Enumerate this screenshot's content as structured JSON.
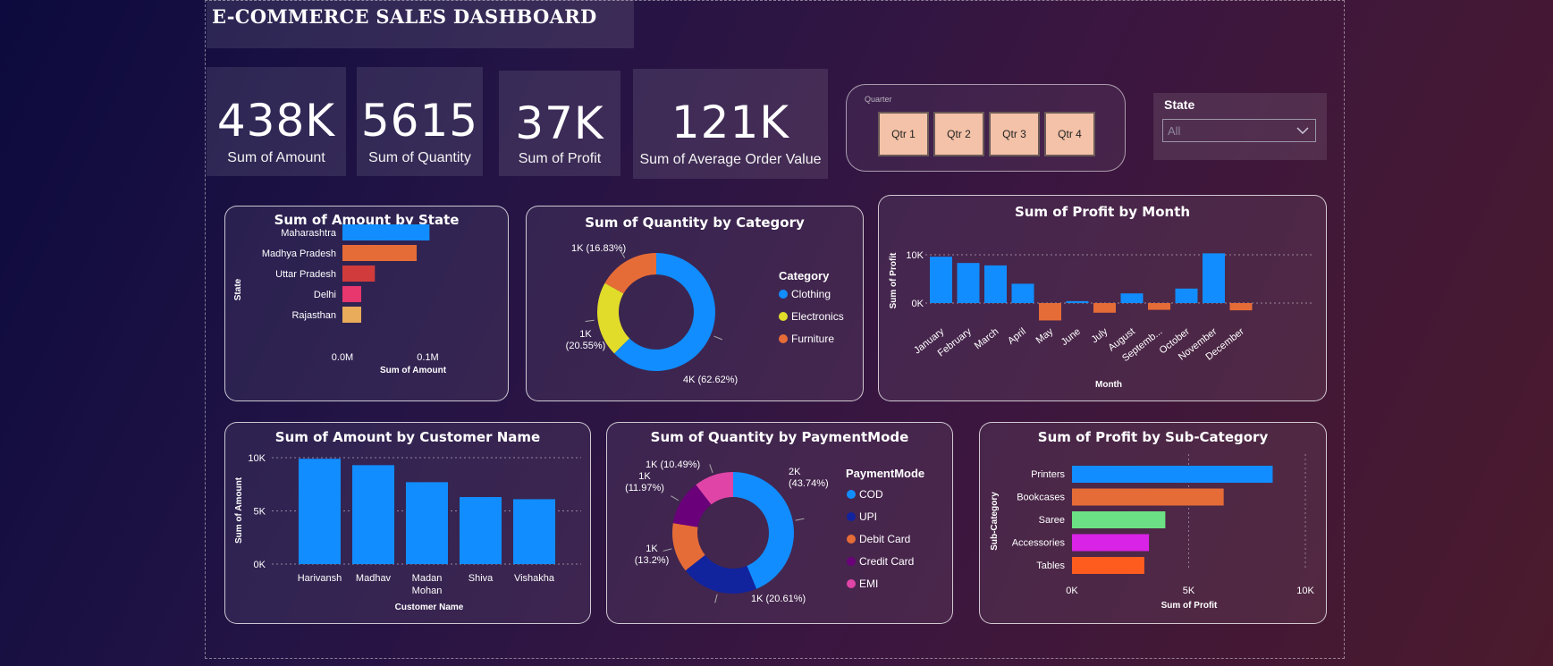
{
  "dashboard": {
    "title": "E-COMMERCE SALES DASHBOARD"
  },
  "kpis": [
    {
      "value": "438K",
      "label": "Sum of Amount"
    },
    {
      "value": "5615",
      "label": "Sum of Quantity"
    },
    {
      "value": "37K",
      "label": "Sum of Profit"
    },
    {
      "value": "121K",
      "label": "Sum of Average Order Value"
    }
  ],
  "quarter_slicer": {
    "caption": "Quarter",
    "buttons": [
      "Qtr 1",
      "Qtr 2",
      "Qtr 3",
      "Qtr 4"
    ]
  },
  "state_slicer": {
    "caption": "State",
    "selected": "All"
  },
  "chart_data": [
    {
      "id": "amount_by_state",
      "type": "bar",
      "orientation": "horizontal",
      "title": "Sum of Amount by State",
      "xlabel": "Sum of Amount",
      "ylabel": "State",
      "categories": [
        "Maharashtra",
        "Madhya Pradesh",
        "Uttar Pradesh",
        "Delhi",
        "Rajasthan"
      ],
      "values": [
        102000,
        87000,
        38000,
        22000,
        22000
      ],
      "colors": [
        "#118dff",
        "#e66c37",
        "#d13b3b",
        "#e8366e",
        "#e8ac5a"
      ],
      "xlim": [
        0,
        110000
      ],
      "xticks": [
        "0.0M",
        "0.1M"
      ],
      "grid": false
    },
    {
      "id": "quantity_by_category",
      "type": "pie",
      "donut": true,
      "title": "Sum of Quantity by Category",
      "legend_title": "Category",
      "legend_position": "right",
      "categories": [
        "Clothing",
        "Electronics",
        "Furniture"
      ],
      "values": [
        62.62,
        20.55,
        16.83
      ],
      "colors": [
        "#118dff",
        "#e1dc2a",
        "#e66c37"
      ],
      "data_labels": [
        "4K (62.62%)",
        "1K (20.55%)",
        "1K (16.83%)"
      ]
    },
    {
      "id": "profit_by_month",
      "type": "bar",
      "title": "Sum of Profit by Month",
      "xlabel": "Month",
      "ylabel": "Sum of Profit",
      "categories": [
        "January",
        "February",
        "March",
        "April",
        "May",
        "June",
        "July",
        "August",
        "Septemb...",
        "October",
        "November",
        "December"
      ],
      "values": [
        9600,
        8300,
        7800,
        4000,
        -3600,
        400,
        -2000,
        2000,
        -1400,
        3000,
        10300,
        -1500
      ],
      "positive_color": "#118dff",
      "negative_color": "#e66c37",
      "ylim": [
        -4000,
        11000
      ],
      "yticks": [
        {
          "value": 10000,
          "label": "10K"
        },
        {
          "value": 0,
          "label": "0K"
        }
      ],
      "grid": true
    },
    {
      "id": "amount_by_customer",
      "type": "bar",
      "title": "Sum of Amount by Customer Name",
      "xlabel": "Customer Name",
      "ylabel": "Sum of Amount",
      "categories": [
        "Harivansh",
        "Madhav",
        "Madan Mohan",
        "Shiva",
        "Vishakha"
      ],
      "values": [
        9900,
        9300,
        7700,
        6300,
        6100
      ],
      "color": "#118dff",
      "ylim": [
        0,
        10000
      ],
      "yticks": [
        {
          "value": 10000,
          "label": "10K"
        },
        {
          "value": 5000,
          "label": "5K"
        },
        {
          "value": 0,
          "label": "0K"
        }
      ],
      "grid": true
    },
    {
      "id": "quantity_by_paymentmode",
      "type": "pie",
      "donut": true,
      "title": "Sum of Quantity by PaymentMode",
      "legend_title": "PaymentMode",
      "legend_position": "right",
      "categories": [
        "COD",
        "UPI",
        "Debit Card",
        "Credit Card",
        "EMI"
      ],
      "values": [
        43.74,
        20.61,
        13.2,
        11.97,
        10.49
      ],
      "colors": [
        "#118dff",
        "#12239e",
        "#e66c37",
        "#6b007b",
        "#e044a7"
      ],
      "data_labels": [
        "2K (43.74%)",
        "1K (20.61%)",
        "1K (13.2%)",
        "1K (11.97%)",
        "1K (10.49%)"
      ]
    },
    {
      "id": "profit_by_subcategory",
      "type": "bar",
      "orientation": "horizontal",
      "title": "Sum of Profit by Sub-Category",
      "xlabel": "Sum of Profit",
      "ylabel": "Sub-Category",
      "categories": [
        "Printers",
        "Bookcases",
        "Saree",
        "Accessories",
        "Tables"
      ],
      "values": [
        8600,
        6500,
        4000,
        3300,
        3100
      ],
      "colors": [
        "#118dff",
        "#e66c37",
        "#6ce084",
        "#d923e6",
        "#fe5c1f"
      ],
      "xlim": [
        0,
        10000
      ],
      "xticks": [
        {
          "value": 0,
          "label": "0K"
        },
        {
          "value": 5000,
          "label": "5K"
        },
        {
          "value": 10000,
          "label": "10K"
        }
      ],
      "grid": true
    }
  ]
}
